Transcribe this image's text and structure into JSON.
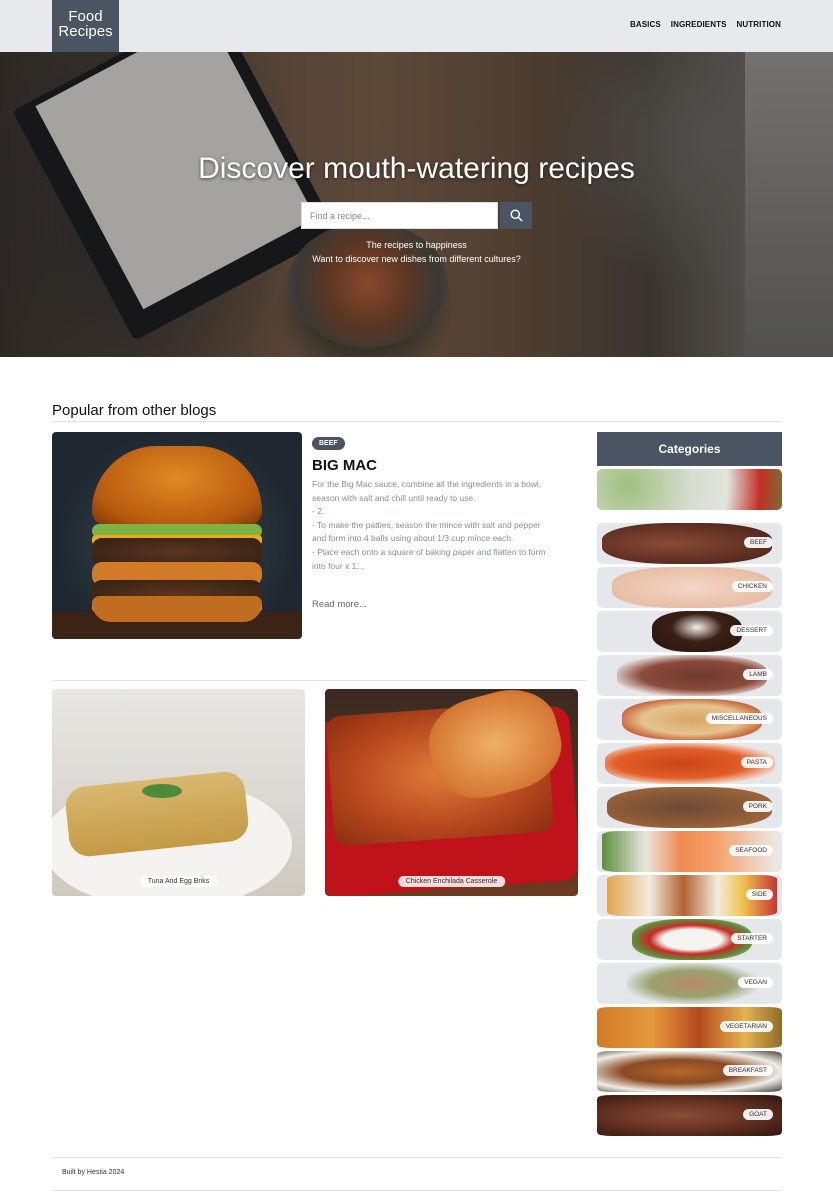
{
  "header": {
    "logo_line1": "Food",
    "logo_line2": "Recipes",
    "nav": [
      "BASICS",
      "INGREDIENTS",
      "NUTRITION"
    ]
  },
  "hero": {
    "title": "Discover mouth-watering recipes",
    "search_placeholder": "Find a recipe...",
    "tagline1": "The recipes to happiness",
    "tagline2": "Want to discover new dishes from different cultures?"
  },
  "popular": {
    "title": "Popular from other blogs",
    "featured": {
      "category": "BEEF",
      "title": "BIG MAC",
      "description": "For the Big Mac sauce, combine all the ingredients in a bowl, season with salt and chill until ready to use.\n- 2.\n- To make the patties, season the mince with salt and pepper and form into 4 balls using about 1/3 cup mince each.\n- Place each onto a square of baking paper and flatten to form into four x 1...",
      "read_more": "Read more..."
    },
    "cards": [
      {
        "label": "Tuna And Egg Briks"
      },
      {
        "label": "Chicken Enchilada Casserole"
      }
    ]
  },
  "categories": {
    "title": "Categories",
    "items": [
      {
        "label": ""
      },
      {
        "label": "BEEF"
      },
      {
        "label": "CHICKEN"
      },
      {
        "label": "DESSERT"
      },
      {
        "label": "LAMB"
      },
      {
        "label": "MISCELLANEOUS"
      },
      {
        "label": "PASTA"
      },
      {
        "label": "PORK"
      },
      {
        "label": "SEAFOOD"
      },
      {
        "label": "SIDE"
      },
      {
        "label": "STARTER"
      },
      {
        "label": "VEGAN"
      },
      {
        "label": "VEGETARIAN"
      },
      {
        "label": "BREAKFAST"
      },
      {
        "label": "GOAT"
      }
    ]
  },
  "footer": {
    "text": "Built by Hestia 2024"
  },
  "colors": {
    "accent": "#4a5462",
    "header_bg": "#e8e9ec"
  }
}
